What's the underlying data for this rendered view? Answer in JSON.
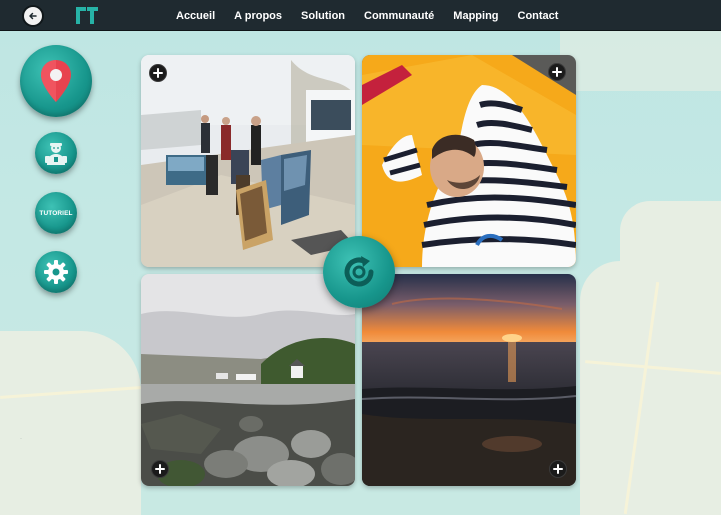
{
  "nav": {
    "items": [
      "Accueil",
      "A propos",
      "Solution",
      "Communauté",
      "Mapping",
      "Contact"
    ]
  },
  "tools": {
    "tutorial_label": "TUTORIEL",
    "icons": [
      "map-pin-icon",
      "user-guide-icon",
      "tutorial-icon",
      "gear-icon"
    ]
  },
  "tiles": [
    {
      "subject": "outdoor art market with paintings on easels"
    },
    {
      "subject": "man in striped shirt resting on yellow kayak"
    },
    {
      "subject": "rocky seashore with houses under cloudy sky"
    },
    {
      "subject": "sunset over the sea with sandy beach"
    }
  ],
  "colors": {
    "topbar": "#1f2a30",
    "accent": "#17968c",
    "map_sea": "#bfe6e3"
  }
}
